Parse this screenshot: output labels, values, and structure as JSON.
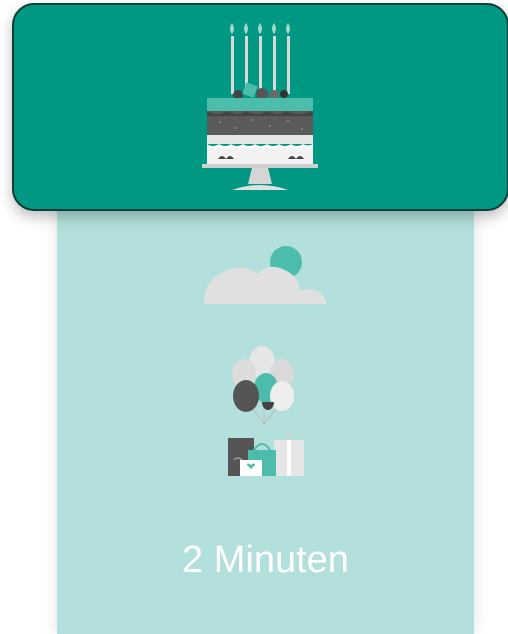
{
  "card": {
    "duration": "2 Minuten"
  },
  "icons": {
    "header": "birthday-cake-icon",
    "cloud": "cloud-icon",
    "balloons": "balloons-icon",
    "gifts": "gifts-icon"
  },
  "colors": {
    "header_bg": "#009883",
    "header_border": "#0c3d36",
    "panel_bg": "#b3e0dc",
    "accent": "#4dbdab",
    "dark": "#555555",
    "light": "#e0e0e0",
    "text": "#ffffff"
  }
}
